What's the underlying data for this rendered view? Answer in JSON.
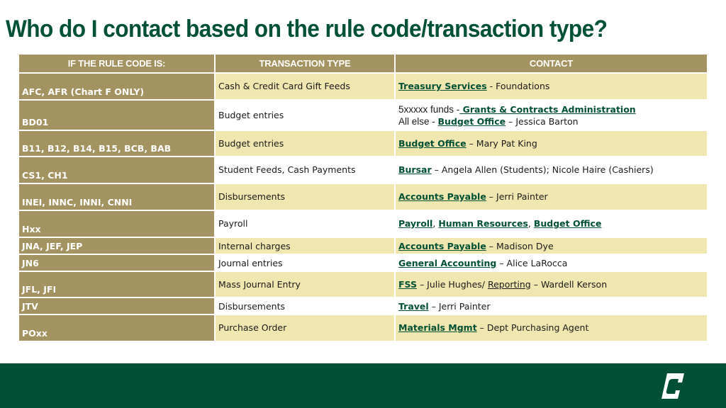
{
  "title": "Who do I contact based on the rule code/transaction type?",
  "colors": {
    "brand_green": "#005035",
    "gold": "#a39361",
    "light_gold": "#f0e6b0"
  },
  "table": {
    "headers": [
      "IF THE RULE CODE IS:",
      "TRANSACTION TYPE",
      "CONTACT"
    ],
    "rows": [
      {
        "code": "AFC, AFR (Chart F ONLY)",
        "transaction": "Cash & Credit Card Gift Feeds",
        "contact": {
          "link1": "Treasury Services",
          "rest": " - Foundations"
        }
      },
      {
        "code": "BD01",
        "transaction": "Budget entries",
        "contact": {
          "line1_prefix": "5xxxxx funds -",
          "line1_link": " Grants & Contracts Administration",
          "line2_prefix": "All else - ",
          "line2_link": "Budget Office",
          "line2_rest": " – Jessica Barton"
        }
      },
      {
        "code": "B11, B12, B14, B15, BCB, BAB",
        "transaction": "Budget entries",
        "contact": {
          "link1": "Budget Office",
          "rest": " – Mary Pat King"
        }
      },
      {
        "code": "CS1, CH1",
        "transaction": "Student Feeds, Cash Payments",
        "contact": {
          "link1": "Bursar",
          "rest": " – Angela Allen (Students); Nicole Haire (Cashiers)"
        }
      },
      {
        "code": "INEI, INNC, INNI, CNNI",
        "transaction": "Disbursements",
        "contact": {
          "link1": "Accounts Payable",
          "rest": " – Jerri Painter"
        }
      },
      {
        "code": "Hxx",
        "transaction": "Payroll",
        "contact": {
          "link1": "Payroll",
          "sep1": ", ",
          "link2": "Human Resources",
          "sep2": ", ",
          "link3": "Budget Office"
        }
      },
      {
        "code": "JNA, JEF, JEP",
        "transaction": "Internal charges",
        "contact": {
          "link1": "Accounts Payable",
          "rest": " – Madison Dye"
        }
      },
      {
        "code": "JN6",
        "transaction": "Journal entries",
        "contact": {
          "link1": "General Accounting",
          "rest": " – Alice LaRocca"
        }
      },
      {
        "code": "JFL, JFI",
        "transaction": "Mass Journal Entry",
        "contact": {
          "link1": "FSS",
          "mid": " – Julie Hughes/ ",
          "link2": "Reporting",
          "rest": " – Wardell Kerson"
        }
      },
      {
        "code": "JTV",
        "transaction": "Disbursements",
        "contact": {
          "link1": "Travel",
          "rest": " – Jerri Painter"
        }
      },
      {
        "code": "POxx",
        "transaction": "Purchase Order",
        "contact": {
          "link1": "Materials Mgmt",
          "rest": " – Dept Purchasing Agent"
        }
      }
    ]
  },
  "footer": {
    "logo_icon": "unc-charlotte-c-logo-icon"
  }
}
